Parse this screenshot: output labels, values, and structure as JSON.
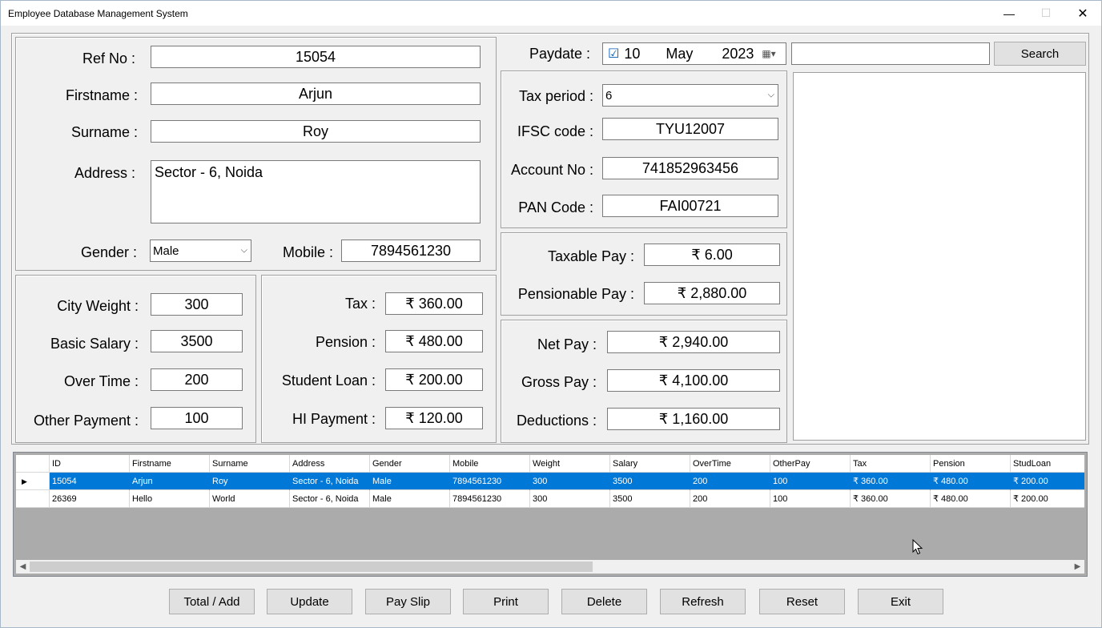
{
  "window": {
    "title": "Employee Database Management System",
    "min_glyph": "—",
    "max_glyph": "☐",
    "close_glyph": "✕"
  },
  "personal": {
    "ref_label": "Ref No :",
    "ref_value": "15054",
    "firstname_label": "Firstname :",
    "firstname_value": "Arjun",
    "surname_label": "Surname :",
    "surname_value": "Roy",
    "address_label": "Address :",
    "address_value": "Sector - 6, Noida",
    "gender_label": "Gender :",
    "gender_value": "Male",
    "mobile_label": "Mobile :",
    "mobile_value": "7894561230"
  },
  "pay_inputs": {
    "city_weight_label": "City Weight :",
    "city_weight_value": "300",
    "basic_salary_label": "Basic Salary :",
    "basic_salary_value": "3500",
    "over_time_label": "Over Time :",
    "over_time_value": "200",
    "other_payment_label": "Other Payment :",
    "other_payment_value": "100"
  },
  "deductions": {
    "tax_label": "Tax :",
    "tax_value": "₹ 360.00",
    "pension_label": "Pension :",
    "pension_value": "₹ 480.00",
    "student_loan_label": "Student Loan :",
    "student_loan_value": "₹ 200.00",
    "hi_payment_label": "HI Payment :",
    "hi_payment_value": "₹ 120.00"
  },
  "paydate": {
    "label": "Paydate :",
    "check": "☑",
    "day": "10",
    "month": "May",
    "year": "2023",
    "picker_glyph": "▦▾"
  },
  "search": {
    "value": "",
    "button_label": "Search"
  },
  "bank": {
    "tax_period_label": "Tax period :",
    "tax_period_value": "6",
    "ifsc_label": "IFSC code :",
    "ifsc_value": "TYU12007",
    "account_label": "Account No :",
    "account_value": "741852963456",
    "pan_label": "PAN Code :",
    "pan_value": "FAI00721"
  },
  "taxable": {
    "taxable_label": "Taxable Pay :",
    "taxable_value": "₹ 6.00",
    "pensionable_label": "Pensionable Pay :",
    "pensionable_value": "₹ 2,880.00"
  },
  "totals": {
    "net_label": "Net Pay :",
    "net_value": "₹ 2,940.00",
    "gross_label": "Gross Pay :",
    "gross_value": "₹ 4,100.00",
    "deductions_label": "Deductions :",
    "deductions_value": "₹ 1,160.00"
  },
  "grid": {
    "columns": [
      "ID",
      "Firstname",
      "Surname",
      "Address",
      "Gender",
      "Mobile",
      "Weight",
      "Salary",
      "OverTime",
      "OtherPay",
      "Tax",
      "Pension",
      "StudLoan"
    ],
    "rows": [
      [
        "15054",
        "Arjun",
        "Roy",
        "Sector - 6, Noida",
        "Male",
        "7894561230",
        "300",
        "3500",
        "200",
        "100",
        "₹ 360.00",
        "₹ 480.00",
        "₹ 200.00"
      ],
      [
        "26369",
        "Hello",
        "World",
        "Sector - 6, Noida",
        "Male",
        "7894561230",
        "300",
        "3500",
        "200",
        "100",
        "₹ 360.00",
        "₹ 480.00",
        "₹ 200.00"
      ]
    ],
    "selected_marker": "▶",
    "scroll_left": "◀",
    "scroll_right": "▶"
  },
  "buttons": {
    "total_add": "Total / Add",
    "update": "Update",
    "pay_slip": "Pay Slip",
    "print": "Print",
    "delete": "Delete",
    "refresh": "Refresh",
    "reset": "Reset",
    "exit": "Exit"
  },
  "icons": {
    "combo_arrow": "⌵"
  }
}
